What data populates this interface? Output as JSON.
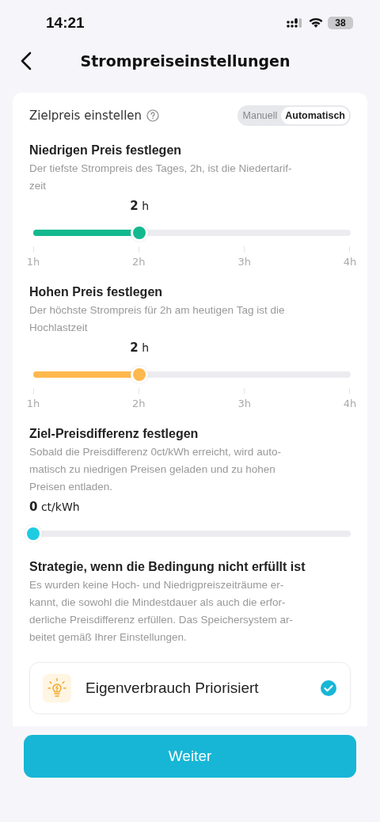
{
  "status_bar": {
    "time": "14:21",
    "battery": "38"
  },
  "header": {
    "title": "Strompreiseinstellungen"
  },
  "target": {
    "label": "Zielpreis einstellen",
    "modes": [
      {
        "label": "Manuell",
        "selected": false
      },
      {
        "label": "Automatisch",
        "selected": true
      }
    ]
  },
  "sections": [
    {
      "kind": "slider",
      "title": "Niedrigen Preis festlegen",
      "description": "Der tiefste Strompreis des Tages, 2h, ist die Niedertarif-\nzeit",
      "value": "**2** h",
      "level": 0.3333,
      "color": "#14b88f",
      "ticks": [
        "1h",
        "2h",
        "3h",
        "4h"
      ]
    },
    {
      "kind": "slider",
      "title": "Hohen Preis festlegen",
      "description": "Der höchste Strompreis für 2h am heutigen Tag ist die\nHochlastzeit",
      "value": "**2** h",
      "level": 0.3333,
      "color": "#ffb84d",
      "ticks": [
        "1h",
        "2h",
        "3h",
        "4h"
      ]
    },
    {
      "kind": "slider",
      "title": "Ziel-Preisdifferenz festlegen",
      "description": "Sobald die Preisdifferenz 0ct/kWh erreicht, wird auto-\nmatisch zu niedrigen Preisen geladen und zu hohen\nPreisen entladen.",
      "value": "**0** ct/kWh",
      "level": 0,
      "color": "#1ecbe1"
    },
    {
      "kind": "text",
      "title": "Strategie, wenn die Bedingung nicht erfüllt ist",
      "description": "Es wurden keine Hoch- und Niedrigpreiszeiträume er-\nkannt, die sowohl die Mindestdauer als auch die erfor-\nderliche Preisdifferenz erfüllen. Das Speichersystem ar-\nbeitet gemäß Ihrer Einstellungen."
    }
  ],
  "option": {
    "label": "Eigenverbrauch Priorisiert",
    "selected": true
  },
  "button": {
    "label": "Weiter"
  }
}
